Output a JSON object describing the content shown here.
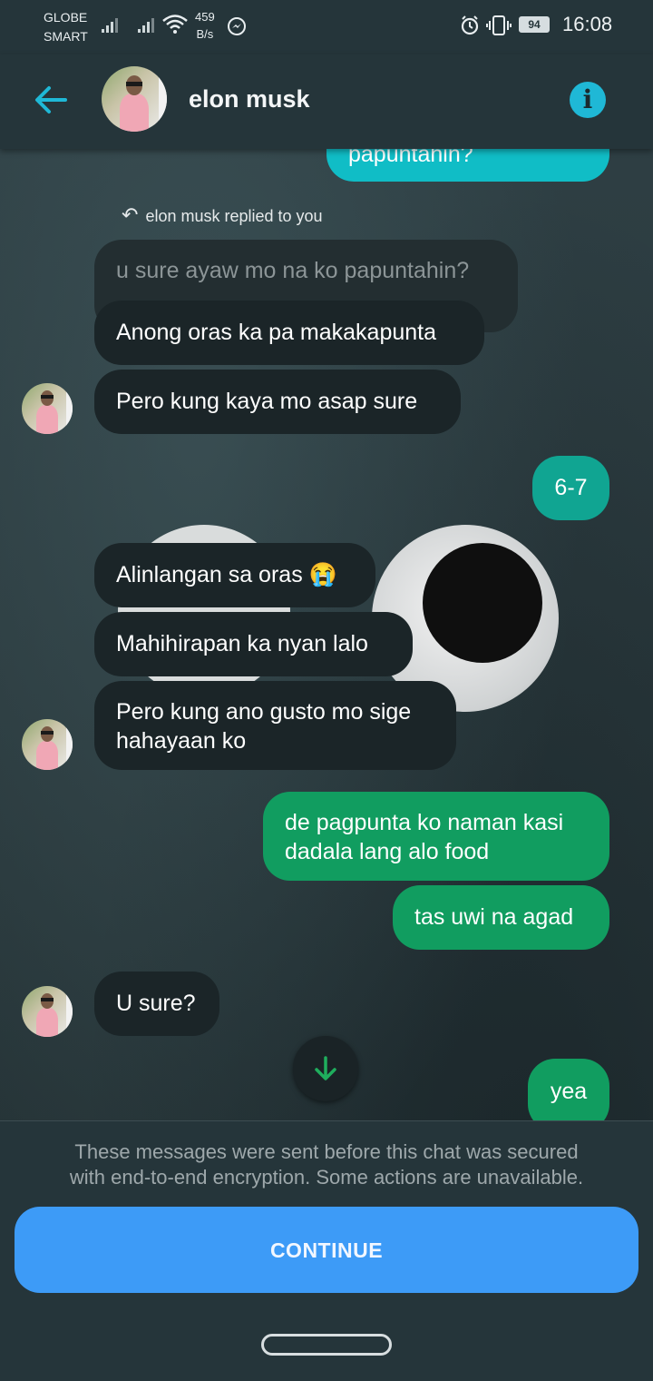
{
  "status_bar": {
    "carrier_line1": "GLOBE",
    "carrier_line2": "SMART",
    "net_speed_value": "459",
    "net_speed_unit": "B/s",
    "battery": "94",
    "time": "16:08"
  },
  "header": {
    "contact_name": "elon musk"
  },
  "chat": {
    "cut_off_message": "papuntahin?",
    "reply_label": "elon musk replied to you",
    "quoted_message": "u sure ayaw mo na ko papuntahin?",
    "messages": [
      {
        "from": "them",
        "text": "Anong oras ka pa makakapunta"
      },
      {
        "from": "them",
        "text": "Pero kung kaya mo asap sure"
      },
      {
        "from": "me",
        "text": "6-7"
      },
      {
        "from": "them",
        "text": "Alinlangan sa oras 😭"
      },
      {
        "from": "them",
        "text": "Mahihirapan ka nyan lalo"
      },
      {
        "from": "them",
        "text": "Pero kung ano gusto mo sige hahayaan ko",
        "line1": "Pero kung ano gusto mo sige",
        "line2": "hahayaan ko"
      },
      {
        "from": "me",
        "text": "de pagpunta ko naman kasi dadala lang alo food",
        "line1": "de pagpunta ko naman kasi",
        "line2": "dadala lang alo food"
      },
      {
        "from": "me",
        "text": "tas uwi na agad"
      },
      {
        "from": "them",
        "text": "U sure?"
      },
      {
        "from": "me",
        "text": "yea"
      }
    ]
  },
  "footer": {
    "notice_line1": "These messages were sent before this chat was secured",
    "notice_line2": "with end-to-end encryption. Some actions are unavailable.",
    "continue_label": "CONTINUE"
  },
  "colors": {
    "incoming_bubble": "#1b2528",
    "outgoing_green": "#119d60",
    "outgoing_teal": "#10a592",
    "outgoing_blue": "#10bdc6",
    "accent": "#3d9bf7"
  },
  "icons": [
    "back-arrow-icon",
    "info-icon",
    "reply-arrow-icon",
    "scroll-down-arrow-icon",
    "messenger-icon",
    "alarm-icon",
    "vibrate-icon",
    "wifi-icon",
    "signal-icon",
    "battery-icon"
  ]
}
